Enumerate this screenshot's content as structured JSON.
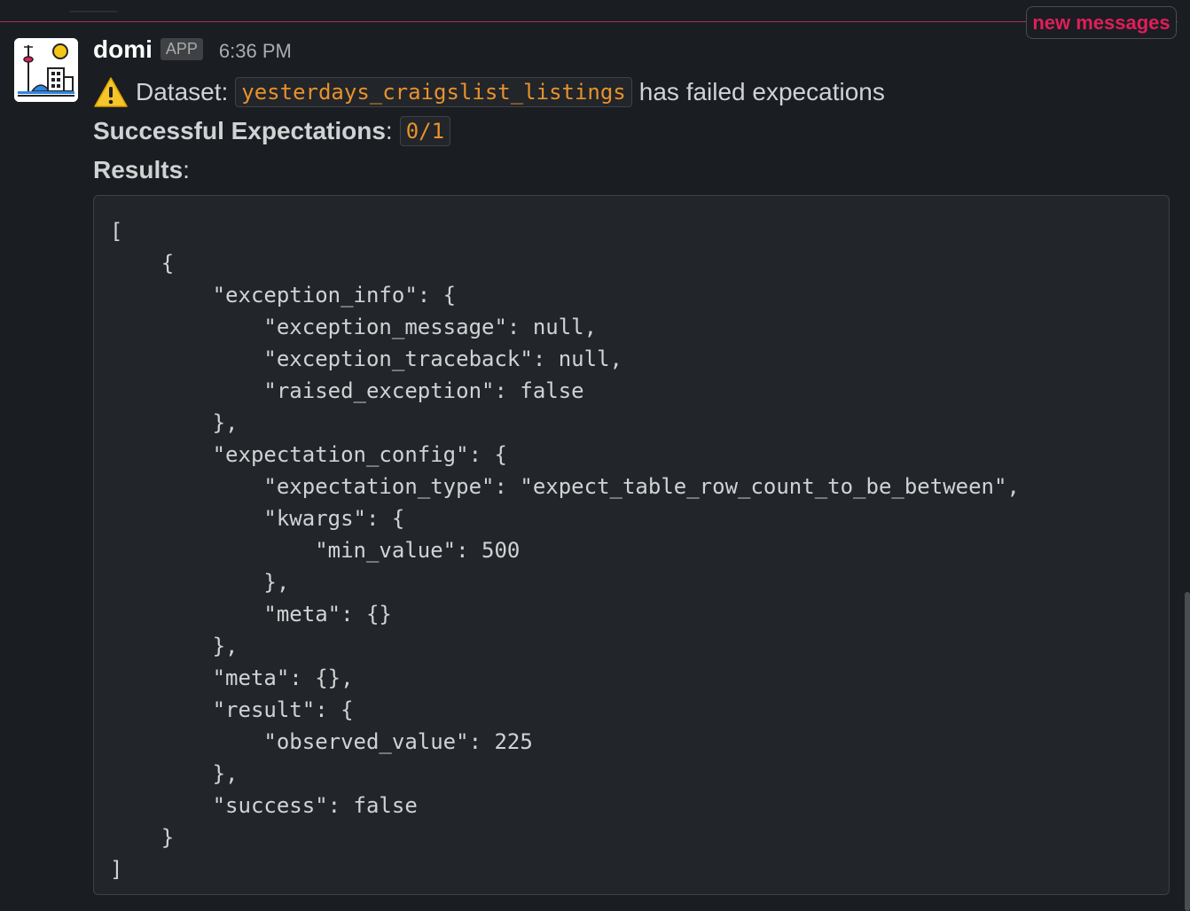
{
  "banner": {
    "new_messages_label": "new messages"
  },
  "message": {
    "sender": "domi",
    "badge": "APP",
    "time": "6:36 PM",
    "line1": {
      "prefix": "Dataset:",
      "dataset": "yesterdays_craigslist_listings",
      "suffix": "has failed expecations"
    },
    "line2": {
      "label": "Successful Expectations",
      "colon": ":",
      "value": "0/1"
    },
    "line3": {
      "label": "Results",
      "colon": ":"
    },
    "code": "[\n    {\n        \"exception_info\": {\n            \"exception_message\": null,\n            \"exception_traceback\": null,\n            \"raised_exception\": false\n        },\n        \"expectation_config\": {\n            \"expectation_type\": \"expect_table_row_count_to_be_between\",\n            \"kwargs\": {\n                \"min_value\": 500\n            },\n            \"meta\": {}\n        },\n        \"meta\": {},\n        \"result\": {\n            \"observed_value\": 225\n        },\n        \"success\": false\n    }\n]"
  },
  "colors": {
    "background": "#1a1d21",
    "accent_red": "#e01e5a",
    "inline_code": "#e8912d"
  },
  "icons": {
    "avatar": "city-skyline-icon",
    "warning": "warning-icon"
  }
}
